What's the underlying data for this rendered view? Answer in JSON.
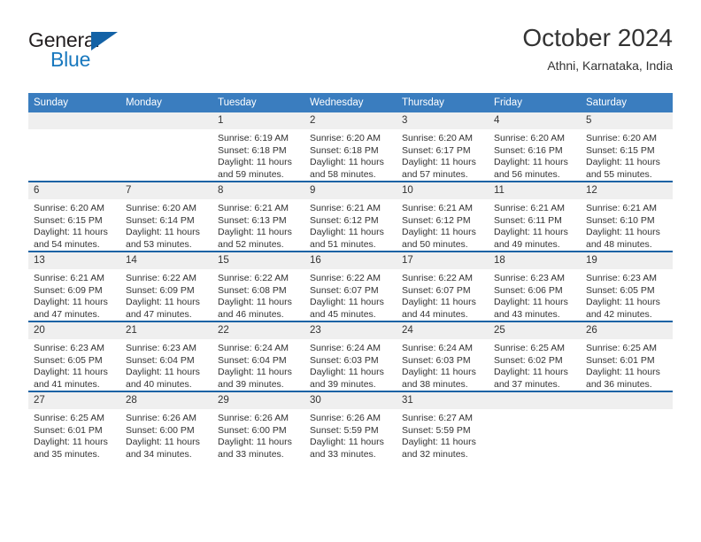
{
  "brand": {
    "name_part1": "General",
    "name_part2": "Blue",
    "flag_icon": "triangle-flag-icon",
    "accent_color": "#1878be",
    "flag_color": "#1362a6"
  },
  "header": {
    "title": "October 2024",
    "subtitle": "Athni, Karnataka, India"
  },
  "theme": {
    "header_row_color": "#3a7dbf",
    "row_divider_color": "#1b63a5",
    "daynum_band_color": "#efefef",
    "text_color": "#333333"
  },
  "weekday_headers": [
    "Sunday",
    "Monday",
    "Tuesday",
    "Wednesday",
    "Thursday",
    "Friday",
    "Saturday"
  ],
  "weeks": [
    [
      {
        "day": "",
        "sunrise": "",
        "sunset": "",
        "daylight_line1": "",
        "daylight_line2": "",
        "empty": true
      },
      {
        "day": "",
        "sunrise": "",
        "sunset": "",
        "daylight_line1": "",
        "daylight_line2": "",
        "empty": true
      },
      {
        "day": "1",
        "sunrise": "Sunrise: 6:19 AM",
        "sunset": "Sunset: 6:18 PM",
        "daylight_line1": "Daylight: 11 hours",
        "daylight_line2": "and 59 minutes."
      },
      {
        "day": "2",
        "sunrise": "Sunrise: 6:20 AM",
        "sunset": "Sunset: 6:18 PM",
        "daylight_line1": "Daylight: 11 hours",
        "daylight_line2": "and 58 minutes."
      },
      {
        "day": "3",
        "sunrise": "Sunrise: 6:20 AM",
        "sunset": "Sunset: 6:17 PM",
        "daylight_line1": "Daylight: 11 hours",
        "daylight_line2": "and 57 minutes."
      },
      {
        "day": "4",
        "sunrise": "Sunrise: 6:20 AM",
        "sunset": "Sunset: 6:16 PM",
        "daylight_line1": "Daylight: 11 hours",
        "daylight_line2": "and 56 minutes."
      },
      {
        "day": "5",
        "sunrise": "Sunrise: 6:20 AM",
        "sunset": "Sunset: 6:15 PM",
        "daylight_line1": "Daylight: 11 hours",
        "daylight_line2": "and 55 minutes."
      }
    ],
    [
      {
        "day": "6",
        "sunrise": "Sunrise: 6:20 AM",
        "sunset": "Sunset: 6:15 PM",
        "daylight_line1": "Daylight: 11 hours",
        "daylight_line2": "and 54 minutes."
      },
      {
        "day": "7",
        "sunrise": "Sunrise: 6:20 AM",
        "sunset": "Sunset: 6:14 PM",
        "daylight_line1": "Daylight: 11 hours",
        "daylight_line2": "and 53 minutes."
      },
      {
        "day": "8",
        "sunrise": "Sunrise: 6:21 AM",
        "sunset": "Sunset: 6:13 PM",
        "daylight_line1": "Daylight: 11 hours",
        "daylight_line2": "and 52 minutes."
      },
      {
        "day": "9",
        "sunrise": "Sunrise: 6:21 AM",
        "sunset": "Sunset: 6:12 PM",
        "daylight_line1": "Daylight: 11 hours",
        "daylight_line2": "and 51 minutes."
      },
      {
        "day": "10",
        "sunrise": "Sunrise: 6:21 AM",
        "sunset": "Sunset: 6:12 PM",
        "daylight_line1": "Daylight: 11 hours",
        "daylight_line2": "and 50 minutes."
      },
      {
        "day": "11",
        "sunrise": "Sunrise: 6:21 AM",
        "sunset": "Sunset: 6:11 PM",
        "daylight_line1": "Daylight: 11 hours",
        "daylight_line2": "and 49 minutes."
      },
      {
        "day": "12",
        "sunrise": "Sunrise: 6:21 AM",
        "sunset": "Sunset: 6:10 PM",
        "daylight_line1": "Daylight: 11 hours",
        "daylight_line2": "and 48 minutes."
      }
    ],
    [
      {
        "day": "13",
        "sunrise": "Sunrise: 6:21 AM",
        "sunset": "Sunset: 6:09 PM",
        "daylight_line1": "Daylight: 11 hours",
        "daylight_line2": "and 47 minutes."
      },
      {
        "day": "14",
        "sunrise": "Sunrise: 6:22 AM",
        "sunset": "Sunset: 6:09 PM",
        "daylight_line1": "Daylight: 11 hours",
        "daylight_line2": "and 47 minutes."
      },
      {
        "day": "15",
        "sunrise": "Sunrise: 6:22 AM",
        "sunset": "Sunset: 6:08 PM",
        "daylight_line1": "Daylight: 11 hours",
        "daylight_line2": "and 46 minutes."
      },
      {
        "day": "16",
        "sunrise": "Sunrise: 6:22 AM",
        "sunset": "Sunset: 6:07 PM",
        "daylight_line1": "Daylight: 11 hours",
        "daylight_line2": "and 45 minutes."
      },
      {
        "day": "17",
        "sunrise": "Sunrise: 6:22 AM",
        "sunset": "Sunset: 6:07 PM",
        "daylight_line1": "Daylight: 11 hours",
        "daylight_line2": "and 44 minutes."
      },
      {
        "day": "18",
        "sunrise": "Sunrise: 6:23 AM",
        "sunset": "Sunset: 6:06 PM",
        "daylight_line1": "Daylight: 11 hours",
        "daylight_line2": "and 43 minutes."
      },
      {
        "day": "19",
        "sunrise": "Sunrise: 6:23 AM",
        "sunset": "Sunset: 6:05 PM",
        "daylight_line1": "Daylight: 11 hours",
        "daylight_line2": "and 42 minutes."
      }
    ],
    [
      {
        "day": "20",
        "sunrise": "Sunrise: 6:23 AM",
        "sunset": "Sunset: 6:05 PM",
        "daylight_line1": "Daylight: 11 hours",
        "daylight_line2": "and 41 minutes."
      },
      {
        "day": "21",
        "sunrise": "Sunrise: 6:23 AM",
        "sunset": "Sunset: 6:04 PM",
        "daylight_line1": "Daylight: 11 hours",
        "daylight_line2": "and 40 minutes."
      },
      {
        "day": "22",
        "sunrise": "Sunrise: 6:24 AM",
        "sunset": "Sunset: 6:04 PM",
        "daylight_line1": "Daylight: 11 hours",
        "daylight_line2": "and 39 minutes."
      },
      {
        "day": "23",
        "sunrise": "Sunrise: 6:24 AM",
        "sunset": "Sunset: 6:03 PM",
        "daylight_line1": "Daylight: 11 hours",
        "daylight_line2": "and 39 minutes."
      },
      {
        "day": "24",
        "sunrise": "Sunrise: 6:24 AM",
        "sunset": "Sunset: 6:03 PM",
        "daylight_line1": "Daylight: 11 hours",
        "daylight_line2": "and 38 minutes."
      },
      {
        "day": "25",
        "sunrise": "Sunrise: 6:25 AM",
        "sunset": "Sunset: 6:02 PM",
        "daylight_line1": "Daylight: 11 hours",
        "daylight_line2": "and 37 minutes."
      },
      {
        "day": "26",
        "sunrise": "Sunrise: 6:25 AM",
        "sunset": "Sunset: 6:01 PM",
        "daylight_line1": "Daylight: 11 hours",
        "daylight_line2": "and 36 minutes."
      }
    ],
    [
      {
        "day": "27",
        "sunrise": "Sunrise: 6:25 AM",
        "sunset": "Sunset: 6:01 PM",
        "daylight_line1": "Daylight: 11 hours",
        "daylight_line2": "and 35 minutes."
      },
      {
        "day": "28",
        "sunrise": "Sunrise: 6:26 AM",
        "sunset": "Sunset: 6:00 PM",
        "daylight_line1": "Daylight: 11 hours",
        "daylight_line2": "and 34 minutes."
      },
      {
        "day": "29",
        "sunrise": "Sunrise: 6:26 AM",
        "sunset": "Sunset: 6:00 PM",
        "daylight_line1": "Daylight: 11 hours",
        "daylight_line2": "and 33 minutes."
      },
      {
        "day": "30",
        "sunrise": "Sunrise: 6:26 AM",
        "sunset": "Sunset: 5:59 PM",
        "daylight_line1": "Daylight: 11 hours",
        "daylight_line2": "and 33 minutes."
      },
      {
        "day": "31",
        "sunrise": "Sunrise: 6:27 AM",
        "sunset": "Sunset: 5:59 PM",
        "daylight_line1": "Daylight: 11 hours",
        "daylight_line2": "and 32 minutes."
      },
      {
        "day": "",
        "sunrise": "",
        "sunset": "",
        "daylight_line1": "",
        "daylight_line2": "",
        "empty": true
      },
      {
        "day": "",
        "sunrise": "",
        "sunset": "",
        "daylight_line1": "",
        "daylight_line2": "",
        "empty": true
      }
    ]
  ]
}
